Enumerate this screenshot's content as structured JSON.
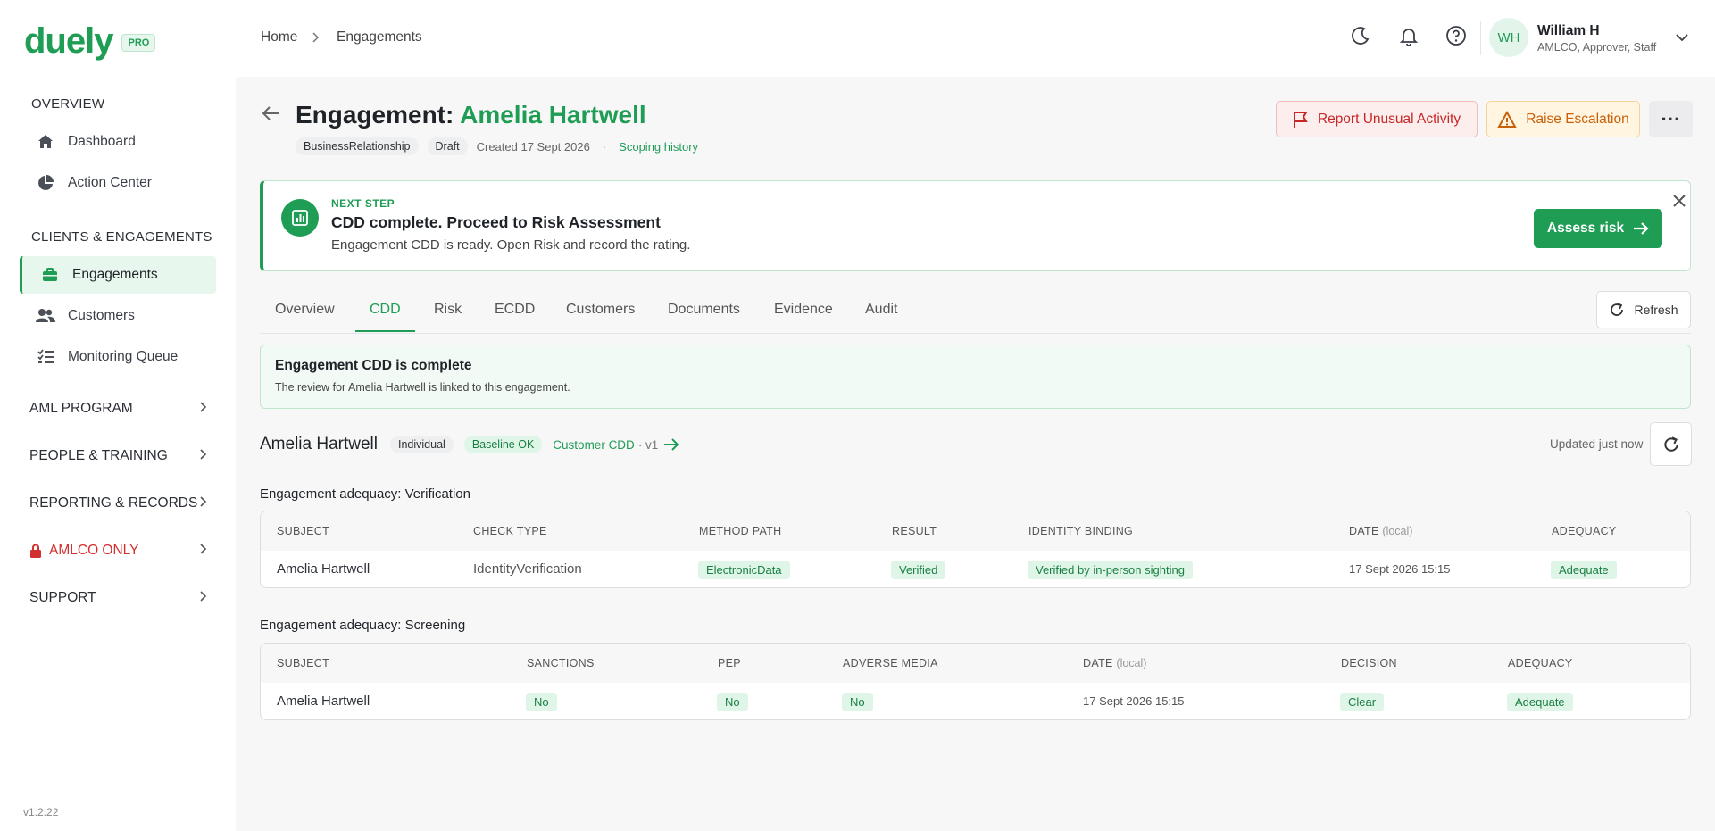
{
  "brand": {
    "logo": "duely",
    "badge": "PRO",
    "version": "v1.2.22"
  },
  "sidebar": {
    "sections": [
      {
        "label": "OVERVIEW",
        "items": [
          {
            "label": "Dashboard"
          },
          {
            "label": "Action Center"
          }
        ]
      },
      {
        "label": "CLIENTS & ENGAGEMENTS",
        "items": [
          {
            "label": "Engagements"
          },
          {
            "label": "Customers"
          },
          {
            "label": "Monitoring Queue"
          }
        ]
      }
    ],
    "groups": [
      {
        "label": "AML PROGRAM"
      },
      {
        "label": "PEOPLE & TRAINING"
      },
      {
        "label": "REPORTING & RECORDS"
      },
      {
        "label": "AMLCO ONLY"
      },
      {
        "label": "SUPPORT"
      }
    ]
  },
  "breadcrumb": {
    "home": "Home",
    "current": "Engagements"
  },
  "user": {
    "initials": "WH",
    "name": "William H",
    "role": "AMLCO, Approver, Staff"
  },
  "header": {
    "title_prefix": "Engagement:",
    "title_name": "Amelia Hartwell",
    "tag_type": "BusinessRelationship",
    "tag_status": "Draft",
    "created": "Created 17 Sept 2026",
    "dot": "·",
    "history_link": "Scoping history",
    "report_button": "Report Unusual Activity",
    "escalation_button": "Raise Escalation",
    "more_button": "···"
  },
  "next_step": {
    "kicker": "NEXT STEP",
    "title": "CDD complete. Proceed to Risk Assessment",
    "description": "Engagement CDD is ready. Open Risk and record the rating.",
    "action": "Assess risk"
  },
  "tabs": [
    {
      "label": "Overview"
    },
    {
      "label": "CDD"
    },
    {
      "label": "Risk"
    },
    {
      "label": "ECDD"
    },
    {
      "label": "Customers"
    },
    {
      "label": "Documents"
    },
    {
      "label": "Evidence"
    },
    {
      "label": "Audit"
    }
  ],
  "active_tab": "CDD",
  "refresh_label": "Refresh",
  "status": {
    "title": "Engagement CDD is complete",
    "description": "The review for Amelia Hartwell is linked to this engagement."
  },
  "subject": {
    "name": "Amelia Hartwell",
    "type": "Individual",
    "baseline": "Baseline OK",
    "cdd_link": "Customer CDD",
    "cdd_version": "· v1",
    "updated": "Updated just now"
  },
  "verification": {
    "heading": "Engagement adequacy: Verification",
    "columns": [
      "SUBJECT",
      "CHECK TYPE",
      "METHOD PATH",
      "RESULT",
      "IDENTITY BINDING",
      "DATE",
      "ADEQUACY"
    ],
    "date_suffix": "(local)",
    "row": {
      "subject": "Amelia Hartwell",
      "check_type": "IdentityVerification",
      "method_path": "ElectronicData",
      "result": "Verified",
      "identity_binding": "Verified by in-person sighting",
      "date": "17 Sept 2026 15:15",
      "adequacy": "Adequate"
    }
  },
  "screening": {
    "heading": "Engagement adequacy: Screening",
    "columns": [
      "SUBJECT",
      "SANCTIONS",
      "PEP",
      "ADVERSE MEDIA",
      "DATE",
      "DECISION",
      "ADEQUACY"
    ],
    "date_suffix": "(local)",
    "row": {
      "subject": "Amelia Hartwell",
      "sanctions": "No",
      "pep": "No",
      "adverse_media": "No",
      "date": "17 Sept 2026 15:15",
      "decision": "Clear",
      "adequacy": "Adequate"
    }
  },
  "colors": {
    "brand": "#1f9d55",
    "danger": "#c62828",
    "warning": "#c8610a"
  }
}
